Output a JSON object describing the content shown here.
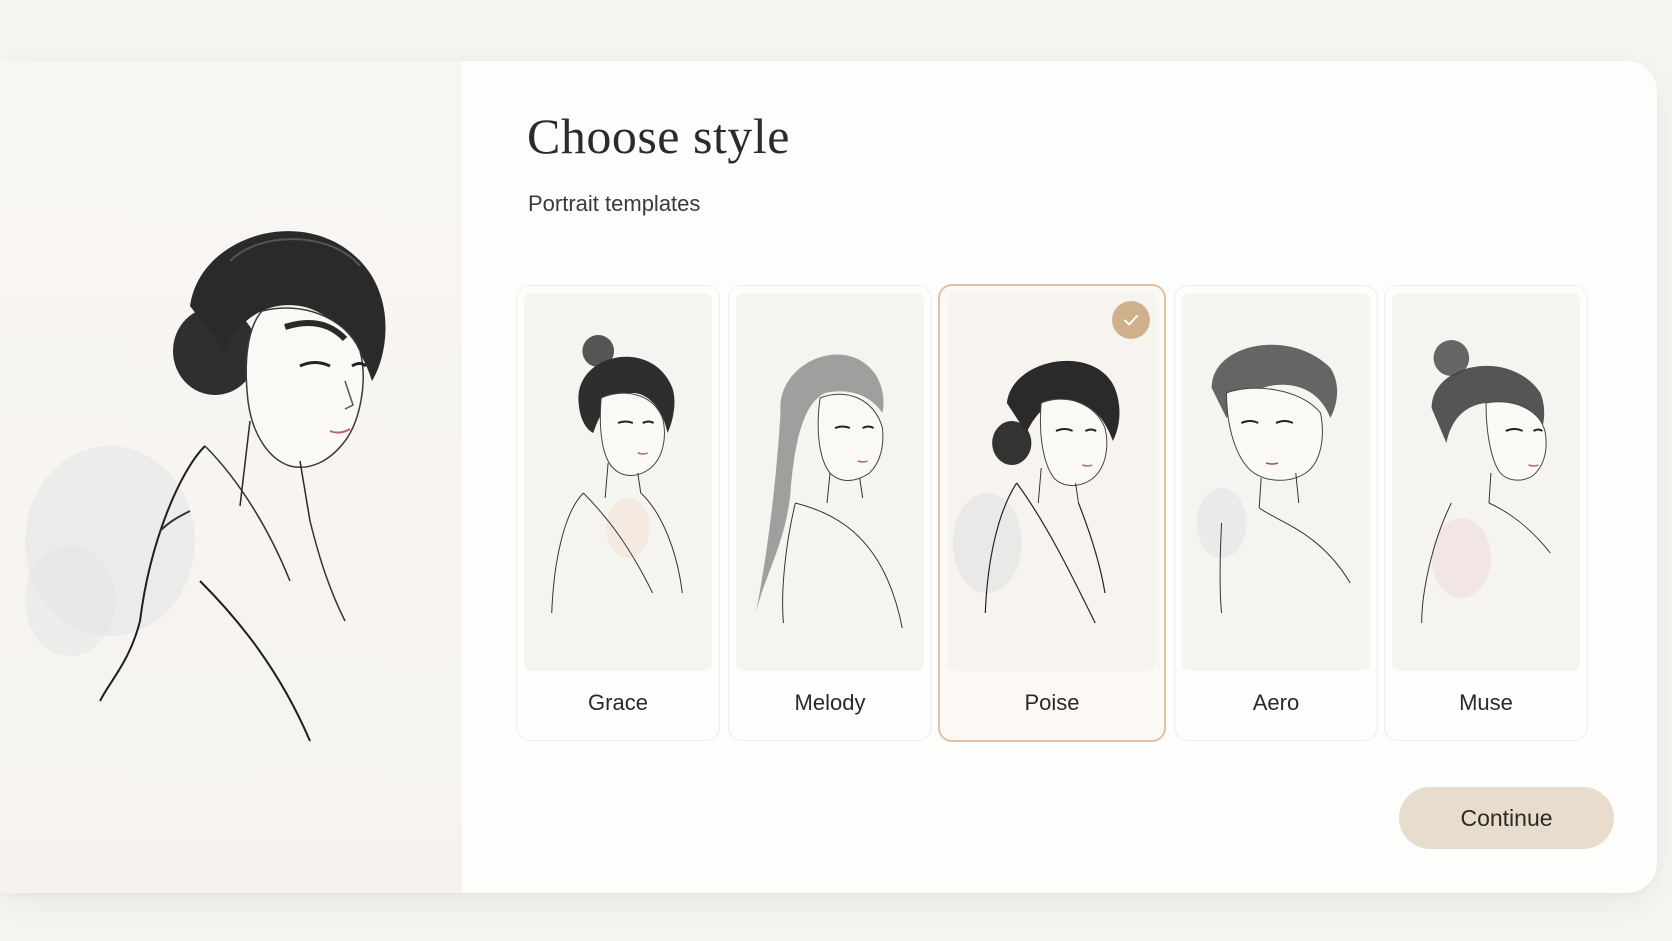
{
  "header": {
    "title": "Choose style",
    "subtitle": "Portrait templates"
  },
  "templates": [
    {
      "name": "Grace",
      "selected": false
    },
    {
      "name": "Melody",
      "selected": false
    },
    {
      "name": "Poise",
      "selected": true
    },
    {
      "name": "Aero",
      "selected": false
    },
    {
      "name": "Muse",
      "selected": false
    }
  ],
  "actions": {
    "continue_label": "Continue"
  },
  "colors": {
    "accent": "#cfb08d",
    "selected_border": "#e2c2a5",
    "button_bg": "#e8dccc",
    "panel_bg": "#fdfdfb"
  },
  "icons": {
    "selected_badge": "check-icon"
  }
}
